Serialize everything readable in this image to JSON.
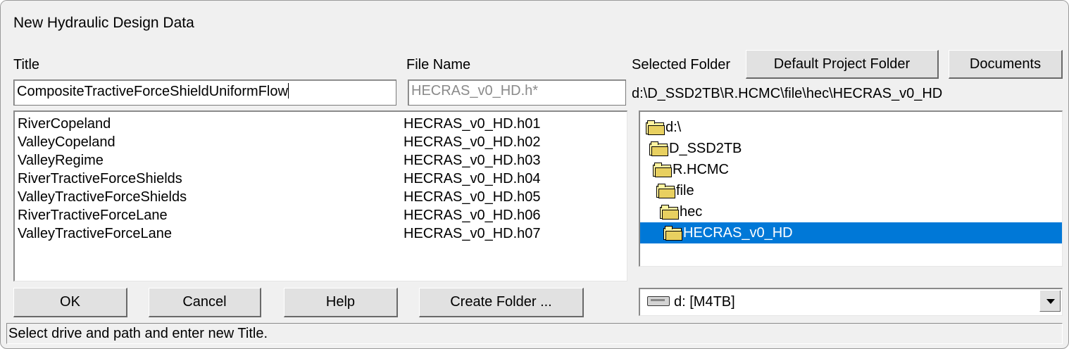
{
  "window": {
    "title": "New Hydraulic Design Data"
  },
  "labels": {
    "title": "Title",
    "file_name": "File Name",
    "selected_folder": "Selected Folder"
  },
  "inputs": {
    "title_value": "CompositeTractiveForceShieldUniformFlow",
    "file_name_value": "HECRAS_v0_HD.h*"
  },
  "buttons": {
    "default_project_folder": "Default Project Folder",
    "documents": "Documents",
    "ok": "OK",
    "cancel": "Cancel",
    "help": "Help",
    "create_folder": "Create Folder ..."
  },
  "selected_path": "d:\\D_SSD2TB\\R.HCMC\\file\\hec\\HECRAS_v0_HD",
  "list": [
    {
      "title": "RiverCopeland",
      "file": "HECRAS_v0_HD.h01"
    },
    {
      "title": "ValleyCopeland",
      "file": "HECRAS_v0_HD.h02"
    },
    {
      "title": "ValleyRegime",
      "file": "HECRAS_v0_HD.h03"
    },
    {
      "title": "RiverTractiveForceShields",
      "file": "HECRAS_v0_HD.h04"
    },
    {
      "title": "ValleyTractiveForceShields",
      "file": "HECRAS_v0_HD.h05"
    },
    {
      "title": "RiverTractiveForceLane",
      "file": "HECRAS_v0_HD.h06"
    },
    {
      "title": "ValleyTractiveForceLane",
      "file": "HECRAS_v0_HD.h07"
    }
  ],
  "folders": [
    {
      "name": "d:\\",
      "selected": false
    },
    {
      "name": "D_SSD2TB",
      "selected": false
    },
    {
      "name": "R.HCMC",
      "selected": false
    },
    {
      "name": "file",
      "selected": false
    },
    {
      "name": "hec",
      "selected": false
    },
    {
      "name": "HECRAS_v0_HD",
      "selected": true
    }
  ],
  "drive": {
    "label": "d: [M4TB]",
    "icon": "hard-drive-icon"
  },
  "status_text": "Select drive and path and enter new Title.",
  "colors": {
    "selection": "#0078d7",
    "window_bg": "#f0f0f0"
  }
}
